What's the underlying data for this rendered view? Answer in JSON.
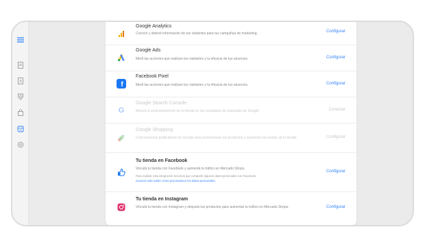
{
  "integrations": [
    {
      "title": "Google Analytics",
      "description": "Conocé y obtené información de tus visitantes para tus campañas de marketing.",
      "action": "Configurar",
      "icon": "google-analytics-icon"
    },
    {
      "title": "Google Ads",
      "description": "Medí las acciones que realizan tus visitantes y la eficacia de tus anuncios.",
      "action": "Configurar",
      "icon": "google-ads-icon"
    },
    {
      "title": "Facebook Pixel",
      "description": "Medí las acciones que realizan tus visitantes y la eficacia de tus anuncios.",
      "action": "Configurar",
      "icon": "facebook-icon"
    },
    {
      "title": "Google Search Console",
      "description": "Mejorá el posicionamiento de tu tienda en los resultados de búsqueda de Google.",
      "action": "Conectar",
      "icon": "google-icon"
    },
    {
      "title": "Google Shopping",
      "description": "Creá anuncios publicitarios en Google para promocionar tus productos y aumentar las ventas de tu tienda.",
      "action": "Configurar",
      "icon": "google-shopping-icon"
    },
    {
      "title": "Tu tienda en Facebook",
      "description": "Vinculá tu tienda con Facebook y aumentá tu tráfico en Mercado Shops.",
      "note": "Para realizar esta integración tenemos que compartir algunos datos personales con Facebook.",
      "link": "Conocé más sobre cómo procesamos los datos personales.",
      "action": "Configurar",
      "icon": "thumbs-up-icon"
    },
    {
      "title": "Tu tienda en Instagram",
      "description": "Vinculá tu tienda con Instagram y etiquetá tus productos para aumentar tu tráfico en Mercado Shops.",
      "action": "Configurar",
      "icon": "instagram-icon"
    }
  ],
  "colors": {
    "accent": "#3483fa",
    "facebook": "#1877f2"
  }
}
